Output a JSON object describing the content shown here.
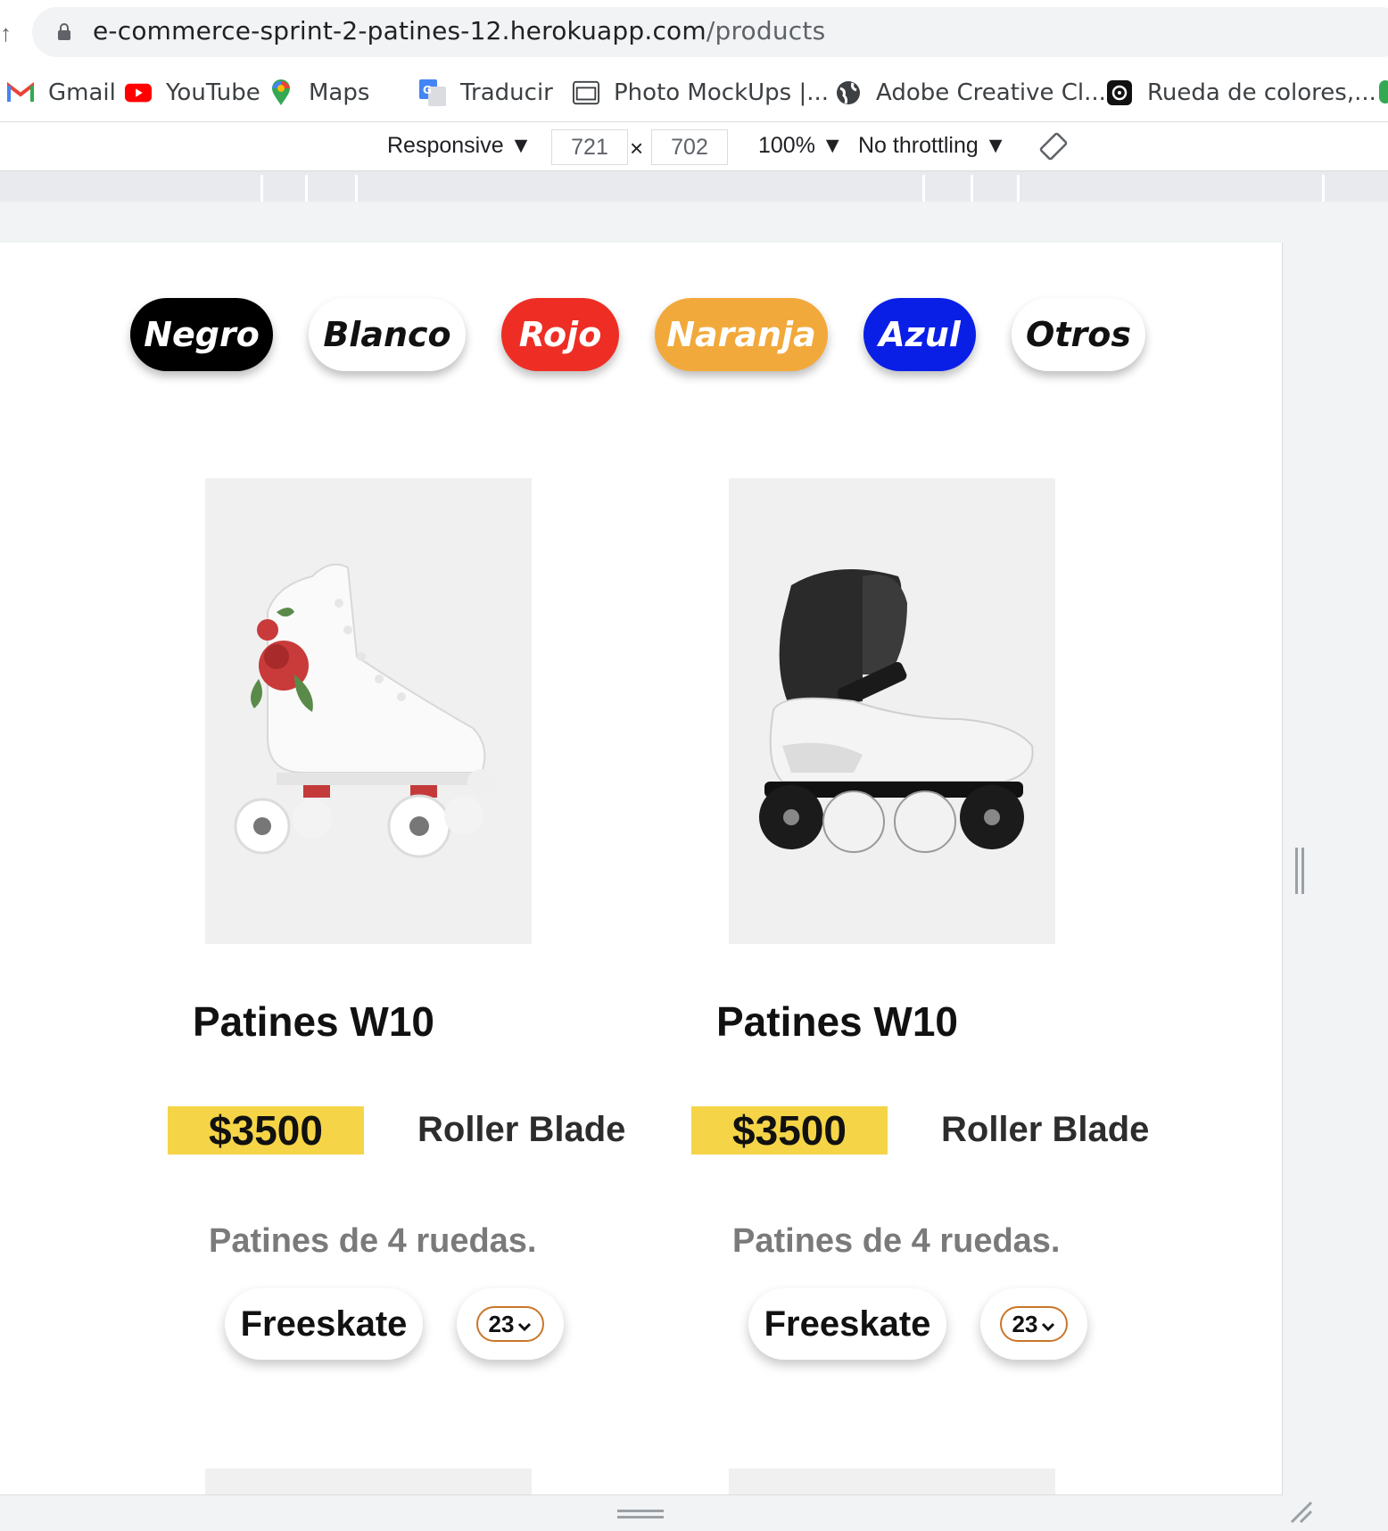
{
  "browser": {
    "url_host": "e-commerce-sprint-2-patines-12.herokuapp.com",
    "url_path": "/products",
    "bookmarks": [
      {
        "label": "Gmail",
        "icon": "gmail-icon"
      },
      {
        "label": "YouTube",
        "icon": "youtube-icon"
      },
      {
        "label": "Maps",
        "icon": "maps-icon"
      },
      {
        "label": "Traducir",
        "icon": "translate-icon"
      },
      {
        "label": "Photo MockUps |...",
        "icon": "photo-mockups-icon"
      },
      {
        "label": "Adobe Creative Cl...",
        "icon": "globe-icon"
      },
      {
        "label": "Rueda de colores,...",
        "icon": "color-wheel-icon"
      }
    ]
  },
  "devtools": {
    "device": "Responsive",
    "width": "721",
    "height": "702",
    "times": "×",
    "zoom": "100%",
    "throttling": "No throttling"
  },
  "filters": [
    {
      "label": "Negro",
      "bg": "#000000",
      "fg": "#ffffff"
    },
    {
      "label": "Blanco",
      "bg": "#ffffff",
      "fg": "#111111"
    },
    {
      "label": "Rojo",
      "bg": "#ee2e24",
      "fg": "#ffffff"
    },
    {
      "label": "Naranja",
      "bg": "#f2a93b",
      "fg": "#ffffff"
    },
    {
      "label": "Azul",
      "bg": "#0a1fe6",
      "fg": "#ffffff"
    },
    {
      "label": "Otros",
      "bg": "#ffffff",
      "fg": "#111111"
    }
  ],
  "products": [
    {
      "title": "Patines W10",
      "price": "$3500",
      "brand": "Roller Blade",
      "description": "Patines de 4 ruedas.",
      "category": "Freeskate",
      "size": "23",
      "image": "quad-roller-skate-image"
    },
    {
      "title": "Patines W10",
      "price": "$3500",
      "brand": "Roller Blade",
      "description": "Patines de 4 ruedas.",
      "category": "Freeskate",
      "size": "23",
      "image": "inline-skate-image"
    }
  ],
  "colors": {
    "price_highlight": "#f5d547",
    "size_border": "#c9762a"
  }
}
